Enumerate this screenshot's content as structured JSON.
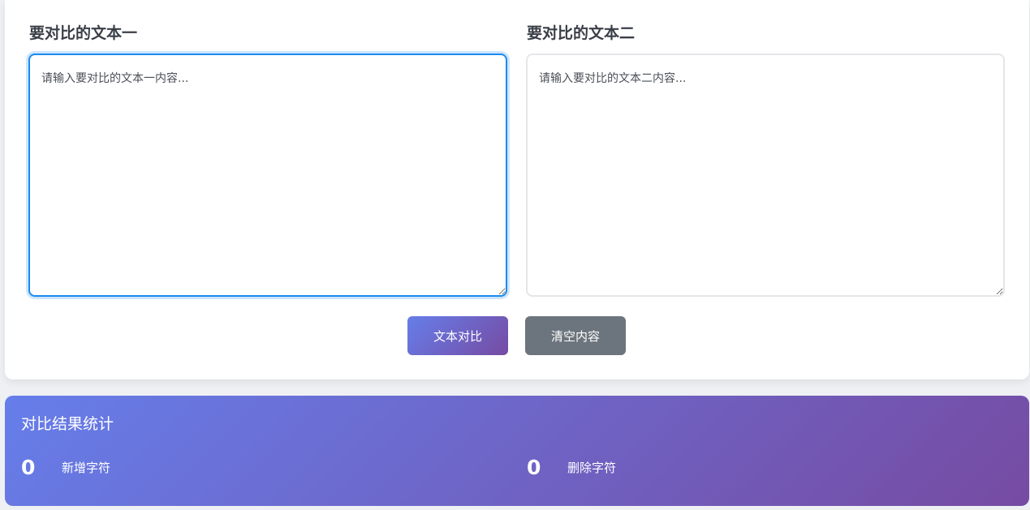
{
  "editors": {
    "text1": {
      "title": "要对比的文本一",
      "placeholder": "请输入要对比的文本一内容...",
      "value": ""
    },
    "text2": {
      "title": "要对比的文本二",
      "placeholder": "请输入要对比的文本二内容...",
      "value": ""
    }
  },
  "actions": {
    "compare_label": "文本对比",
    "clear_label": "清空内容"
  },
  "results": {
    "title": "对比结果统计",
    "added": {
      "value": "0",
      "label": "新增字符"
    },
    "removed": {
      "value": "0",
      "label": "删除字符"
    }
  },
  "colors": {
    "accent_gradient_start": "#667eea",
    "accent_gradient_end": "#764ba2",
    "focus_border": "#1b8af0",
    "clear_button": "#6c757d"
  }
}
